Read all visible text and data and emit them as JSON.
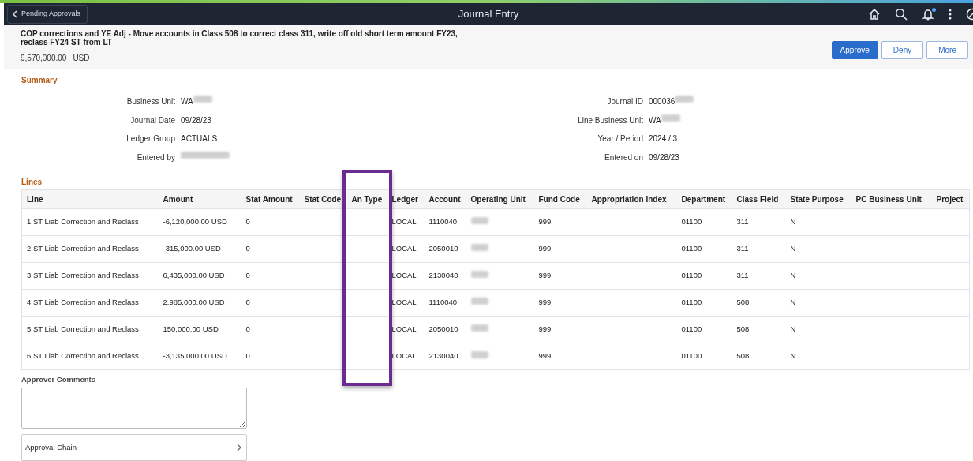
{
  "navbar": {
    "back_button": "Pending Approvals",
    "title": "Journal Entry",
    "has_notification": true
  },
  "header": {
    "description": "COP corrections and YE Adj - Move accounts in Class 508 to correct class 311, write off old short term amount FY23, reclass FY24 ST from LT",
    "amount": "9,570,000.00",
    "currency": "USD",
    "buttons": [
      {
        "label": "Approve",
        "kind": "primary"
      },
      {
        "label": "Deny",
        "kind": "secondary"
      },
      {
        "label": "More",
        "kind": "secondary"
      }
    ]
  },
  "summary": {
    "title": "Summary",
    "left": [
      {
        "label": "Business Unit",
        "value": "WA",
        "redacted": true
      },
      {
        "label": "Journal Date",
        "value": "09/28/23",
        "redacted": false
      },
      {
        "label": "Ledger Group",
        "value": "ACTUALS",
        "redacted": false
      },
      {
        "label": "Entered by",
        "redacted": true
      }
    ],
    "right": [
      {
        "label": "Journal ID",
        "value": "000036",
        "redacted": true
      },
      {
        "label": "Line Business Unit",
        "value": "WA",
        "redacted": true
      },
      {
        "label": "Year / Period",
        "value": "2024 / 3",
        "redacted": false
      },
      {
        "label": "Entered on",
        "value": "09/28/23",
        "redacted": false
      }
    ]
  },
  "lines": {
    "title": "Lines",
    "columns": [
      {
        "label": "Line",
        "highlighted": false
      },
      {
        "label": "Amount",
        "highlighted": false
      },
      {
        "label": "Stat Amount",
        "highlighted": false
      },
      {
        "label": "Stat Code",
        "highlighted": false
      },
      {
        "label": "An Type",
        "highlighted": true
      },
      {
        "label": "Ledger",
        "highlighted": false
      },
      {
        "label": "Account",
        "highlighted": false
      },
      {
        "label": "Operating Unit",
        "highlighted": false
      },
      {
        "label": "Fund Code",
        "highlighted": false
      },
      {
        "label": "Appropriation Index",
        "highlighted": false
      },
      {
        "label": "Department",
        "highlighted": false
      },
      {
        "label": "Class Field",
        "highlighted": false
      },
      {
        "label": "State Purpose",
        "highlighted": false
      },
      {
        "label": "PC Business Unit",
        "highlighted": false
      },
      {
        "label": "Project",
        "highlighted": false
      }
    ],
    "rows": [
      {
        "cells": [
          "1 ST Liab Correction and Reclass",
          "-6,120,000.00 USD",
          "0",
          null,
          null,
          "LOCAL",
          "1110040",
          {
            "redacted": true
          },
          "999",
          null,
          "01100",
          "311",
          "N"
        ]
      },
      {
        "cells": [
          "2 ST Liab Correction and Reclass",
          "-315,000.00 USD",
          "0",
          null,
          null,
          "LOCAL",
          "2050010",
          {
            "redacted": true
          },
          "999",
          null,
          "01100",
          "311",
          "N"
        ]
      },
      {
        "cells": [
          "3 ST Liab Correction and Reclass",
          "6,435,000.00 USD",
          "0",
          null,
          null,
          "LOCAL",
          "2130040",
          {
            "redacted": true
          },
          "999",
          null,
          "01100",
          "311",
          "N"
        ]
      },
      {
        "cells": [
          "4 ST Liab Correction and Reclass",
          "2,985,000.00 USD",
          "0",
          null,
          null,
          "LOCAL",
          "1110040",
          {
            "redacted": true
          },
          "999",
          null,
          "01100",
          "508",
          "N"
        ]
      },
      {
        "cells": [
          "5 ST Liab Correction and Reclass",
          "150,000.00 USD",
          "0",
          null,
          null,
          "LOCAL",
          "2050010",
          {
            "redacted": true
          },
          "999",
          null,
          "01100",
          "508",
          "N"
        ]
      },
      {
        "cells": [
          "6 ST Liab Correction and Reclass",
          "-3,135,000.00 USD",
          "0",
          null,
          null,
          "LOCAL",
          "2130040",
          {
            "redacted": true
          },
          "999",
          null,
          "01100",
          "508",
          "N"
        ]
      }
    ]
  },
  "comments": {
    "label": "Approver Comments"
  },
  "approval_chain": {
    "label": "Approval Chain"
  }
}
